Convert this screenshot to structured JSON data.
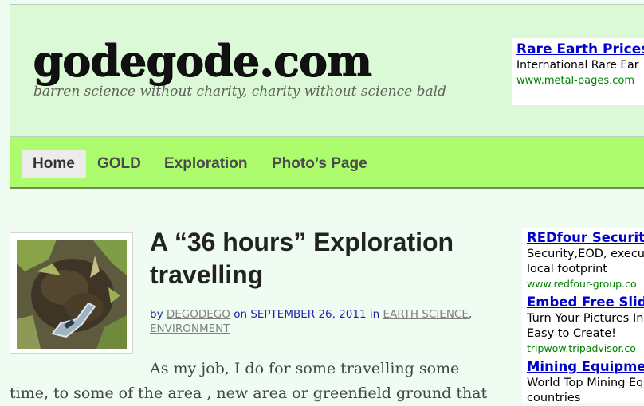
{
  "site": {
    "title": "godegode.com",
    "tagline": "barren science without charity, charity without science bald"
  },
  "top_ad": {
    "title": "Rare Earth Prices",
    "text": "International Rare Ear",
    "url": "www.metal-pages.com"
  },
  "nav": {
    "items": [
      {
        "label": "Home",
        "active": true
      },
      {
        "label": "GOLD",
        "active": false
      },
      {
        "label": "Exploration",
        "active": false
      },
      {
        "label": "Photo’s Page",
        "active": false
      }
    ]
  },
  "post": {
    "title": "A “36 hours” Exploration travelling",
    "meta": {
      "by": "by",
      "author": "DEGODEGO",
      "on": "on",
      "date": "SEPTEMBER 26, 2011",
      "in": "in",
      "category1": "EARTH SCIENCE",
      "comma": ",",
      "category2": "ENVIRONMENT"
    },
    "body_line1": "As my job, I do for some travelling some",
    "body_line2": "time, to some of the area , new area or greenfield ground that"
  },
  "side_ads": [
    {
      "title": "REDfour Security",
      "lines": [
        "Security,EOD, execu",
        "local footprint"
      ],
      "url": "www.redfour-group.co"
    },
    {
      "title": "Embed Free Slide",
      "lines": [
        "Turn Your Pictures In",
        "Easy to Create!"
      ],
      "url": "tripwow.tripadvisor.co"
    },
    {
      "title": "Mining Equipmen",
      "lines": [
        "World Top Mining Eq",
        "countries"
      ],
      "url": ""
    }
  ],
  "colors": {
    "header_bg": "#dbf9d7",
    "nav_bg": "#acfc6e",
    "page_bg": "#eefcf1",
    "ad_link": "#0000cc",
    "ad_url": "#008000"
  }
}
